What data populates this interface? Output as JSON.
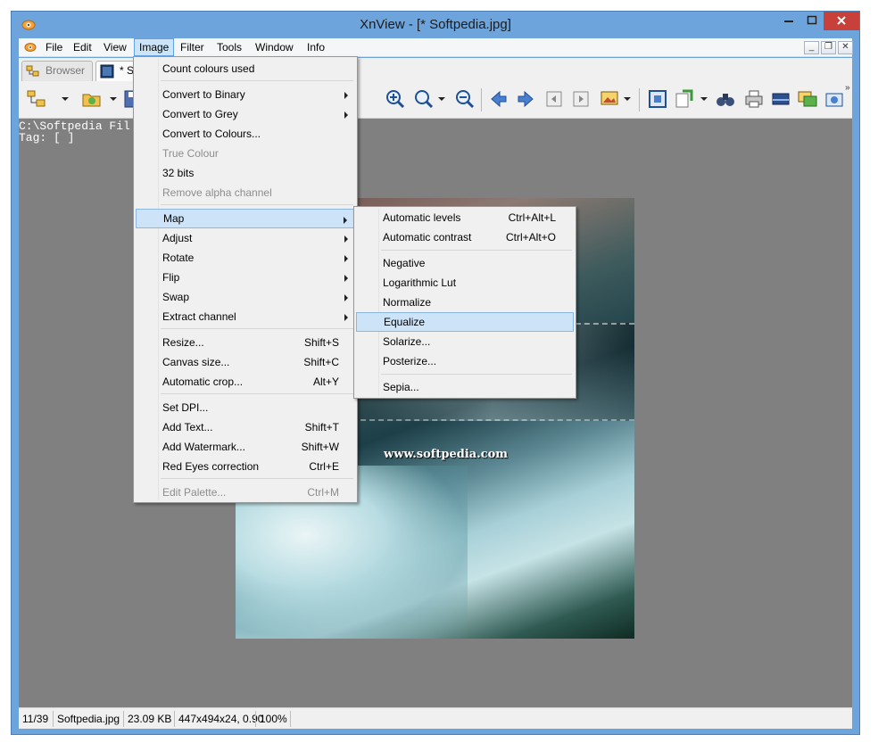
{
  "window": {
    "title": "XnView - [* Softpedia.jpg]"
  },
  "titlebar_buttons": {
    "minimize": "–",
    "maximize": "□",
    "close": "✕"
  },
  "menubar": {
    "items": [
      "File",
      "Edit",
      "View",
      "Image",
      "Filter",
      "Tools",
      "Window",
      "Info"
    ],
    "active": "Image",
    "mdi_buttons": [
      "_",
      "❐",
      "✕"
    ]
  },
  "tabs": [
    {
      "label": "Browser"
    },
    {
      "label": "* S"
    }
  ],
  "viewer": {
    "path_line": "C:\\Softpedia Fil",
    "tag_line": "Tag: [ ]"
  },
  "picture": {
    "watermark_url": "www.softpedia.com"
  },
  "image_menu": {
    "items": [
      {
        "label": "Count colours used",
        "shortcut": "",
        "submenu": false,
        "disabled": false
      },
      {
        "label": "Convert to Binary",
        "shortcut": "",
        "submenu": true,
        "disabled": false
      },
      {
        "label": "Convert to Grey",
        "shortcut": "",
        "submenu": true,
        "disabled": false
      },
      {
        "label": "Convert to Colours...",
        "shortcut": "",
        "submenu": false,
        "disabled": false
      },
      {
        "label": "True Colour",
        "shortcut": "",
        "submenu": false,
        "disabled": true
      },
      {
        "label": "32 bits",
        "shortcut": "",
        "submenu": false,
        "disabled": false
      },
      {
        "label": "Remove alpha channel",
        "shortcut": "",
        "submenu": false,
        "disabled": true
      },
      {
        "label": "Map",
        "shortcut": "",
        "submenu": true,
        "disabled": false,
        "highlighted": true
      },
      {
        "label": "Adjust",
        "shortcut": "",
        "submenu": true,
        "disabled": false
      },
      {
        "label": "Rotate",
        "shortcut": "",
        "submenu": true,
        "disabled": false
      },
      {
        "label": "Flip",
        "shortcut": "",
        "submenu": true,
        "disabled": false
      },
      {
        "label": "Swap",
        "shortcut": "",
        "submenu": true,
        "disabled": false
      },
      {
        "label": "Extract channel",
        "shortcut": "",
        "submenu": true,
        "disabled": false
      },
      {
        "label": "Resize...",
        "shortcut": "Shift+S",
        "submenu": false,
        "disabled": false
      },
      {
        "label": "Canvas size...",
        "shortcut": "Shift+C",
        "submenu": false,
        "disabled": false
      },
      {
        "label": "Automatic crop...",
        "shortcut": "Alt+Y",
        "submenu": false,
        "disabled": false
      },
      {
        "label": "Set DPI...",
        "shortcut": "",
        "submenu": false,
        "disabled": false
      },
      {
        "label": "Add Text...",
        "shortcut": "Shift+T",
        "submenu": false,
        "disabled": false
      },
      {
        "label": "Add Watermark...",
        "shortcut": "Shift+W",
        "submenu": false,
        "disabled": false
      },
      {
        "label": "Red Eyes correction",
        "shortcut": "Ctrl+E",
        "submenu": false,
        "disabled": false
      },
      {
        "label": "Edit Palette...",
        "shortcut": "Ctrl+M",
        "submenu": false,
        "disabled": true
      }
    ]
  },
  "map_submenu": {
    "items": [
      {
        "label": "Automatic levels",
        "shortcut": "Ctrl+Alt+L"
      },
      {
        "label": "Automatic contrast",
        "shortcut": "Ctrl+Alt+O"
      },
      {
        "label": "Negative",
        "shortcut": ""
      },
      {
        "label": "Logarithmic Lut",
        "shortcut": ""
      },
      {
        "label": "Normalize",
        "shortcut": ""
      },
      {
        "label": "Equalize",
        "shortcut": "",
        "highlighted": true
      },
      {
        "label": "Solarize...",
        "shortcut": ""
      },
      {
        "label": "Posterize...",
        "shortcut": ""
      },
      {
        "label": "Sepia...",
        "shortcut": ""
      }
    ]
  },
  "statusbar": {
    "position": "11/39",
    "filename": "Softpedia.jpg",
    "filesize": "23.09 KB",
    "dimensions": "447x494x24, 0.90",
    "zoom": "100%"
  },
  "colors": {
    "accent": "#6da4dc",
    "close": "#c7403a",
    "highlight": "#cde3f7"
  }
}
